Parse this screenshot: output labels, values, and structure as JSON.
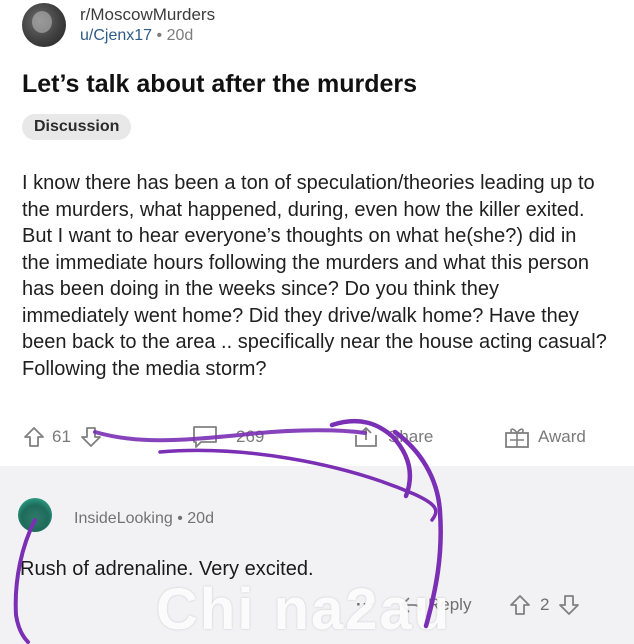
{
  "post": {
    "subreddit": "r/MoscowMurders",
    "username": "u/Cjenx17",
    "separator": "•",
    "age": "20d",
    "title": "Let’s talk about after the murders",
    "flair": "Discussion",
    "body": "I know there has been a ton of speculation/theories leading up to the murders, what happened, during, even how the killer exited. But I want to hear everyone’s thoughts on what he(she?) did in the immediate hours following the murders and what this person has been doing in the weeks since? Do you think they immediately went home? Did they drive/walk home? Have they been back to the area .. specifically near the house acting casual? Following the media storm?"
  },
  "actions": {
    "upvotes": "61",
    "comments": "269",
    "share_label": "Share",
    "award_label": "Award"
  },
  "comment": {
    "username": "InsideLooking",
    "separator": "•",
    "age": "20d",
    "text": "Rush of adrenaline. Very excited.",
    "more": "···",
    "reply_label": "Reply",
    "votes": "2"
  },
  "watermark": "Chi na2au",
  "colors": {
    "scribble": "#7a2fb4",
    "comment_bg": "#f2f2f4"
  },
  "icons": [
    "upvote-icon",
    "downvote-icon",
    "comment-icon",
    "share-icon",
    "award-icon",
    "reply-icon"
  ]
}
